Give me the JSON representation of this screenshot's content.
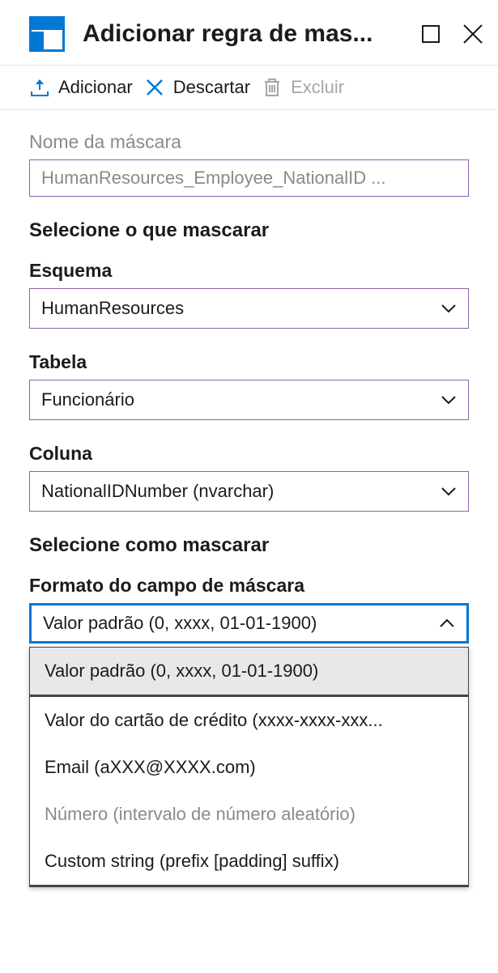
{
  "header": {
    "title": "Adicionar regra de mas..."
  },
  "toolbar": {
    "add_label": "Adicionar",
    "discard_label": "Descartar",
    "delete_label": "Excluir"
  },
  "fields": {
    "mask_name_label": "Nome da máscara",
    "mask_name_value": "HumanResources_Employee_NationalID  ...",
    "select_what_title": "Selecione o que mascarar",
    "schema_label": "Esquema",
    "schema_value": "HumanResources",
    "table_label": "Tabela",
    "table_value": "Funcionário",
    "column_label": "Coluna",
    "column_value": "NationalIDNumber (nvarchar)",
    "select_how_title": "Selecione como mascarar",
    "format_label": "Formato do campo de máscara",
    "format_value": "Valor padrão (0, xxxx, 01-01-1900)",
    "format_options": [
      {
        "label": "Valor padrão (0, xxxx, 01-01-1900)",
        "selected": true,
        "disabled": false
      },
      {
        "label": "Valor do cartão de crédito (xxxx-xxxx-xxx...",
        "selected": false,
        "disabled": false
      },
      {
        "label": "Email (aXXX@XXXX.com)",
        "selected": false,
        "disabled": false
      },
      {
        "label": "Número (intervalo de número aleatório)",
        "selected": false,
        "disabled": true
      },
      {
        "label": "Custom string (prefix [padding] suffix)",
        "selected": false,
        "disabled": false
      }
    ]
  }
}
